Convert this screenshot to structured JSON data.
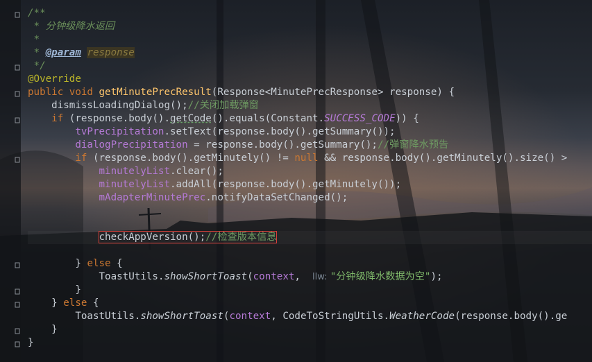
{
  "editor": {
    "lines": [
      {
        "indent": "",
        "tokens": [
          {
            "t": "/**",
            "c": "doc"
          }
        ]
      },
      {
        "indent": " ",
        "tokens": [
          {
            "t": "* 分钟级降水返回",
            "c": "doc"
          }
        ]
      },
      {
        "indent": " ",
        "tokens": [
          {
            "t": "*",
            "c": "doc"
          }
        ]
      },
      {
        "indent": " ",
        "tokens": [
          {
            "t": "* ",
            "c": "doc"
          },
          {
            "t": "@param",
            "c": "tag"
          },
          {
            "t": " ",
            "c": "doc"
          },
          {
            "t": "response",
            "c": "param"
          }
        ]
      },
      {
        "indent": " ",
        "tokens": [
          {
            "t": "*/",
            "c": "doc"
          }
        ]
      },
      {
        "indent": "",
        "tokens": [
          {
            "t": "@Override",
            "c": "ann"
          }
        ]
      },
      {
        "indent": "",
        "tokens": [
          {
            "t": "public void ",
            "c": "kw"
          },
          {
            "t": "getMinutePrecResult",
            "c": "meth"
          },
          {
            "t": "(Response<MinutePrecResponse> response) {",
            "c": "plain"
          }
        ]
      },
      {
        "indent": "    ",
        "tokens": [
          {
            "t": "dismissLoadingDialog();",
            "c": "plain"
          },
          {
            "t": "//关闭加载弹窗",
            "c": "com"
          }
        ]
      },
      {
        "indent": "    ",
        "tokens": [
          {
            "t": "if ",
            "c": "kw"
          },
          {
            "t": "(response.body().",
            "c": "plain"
          },
          {
            "t": "getCode",
            "c": "plain-dotted"
          },
          {
            "t": "().equals(Constant.",
            "c": "plain"
          },
          {
            "t": "SUCCESS_CODE",
            "c": "static"
          },
          {
            "t": ")) {",
            "c": "plain"
          }
        ]
      },
      {
        "indent": "        ",
        "tokens": [
          {
            "t": "tvPrecipitation",
            "c": "field"
          },
          {
            "t": ".setText(response.body().getSummary());",
            "c": "plain"
          }
        ]
      },
      {
        "indent": "        ",
        "tokens": [
          {
            "t": "dialogPrecipitation",
            "c": "field"
          },
          {
            "t": " = response.body().getSummary();",
            "c": "plain"
          },
          {
            "t": "//弹窗降水预告",
            "c": "com"
          }
        ]
      },
      {
        "indent": "        ",
        "tokens": [
          {
            "t": "if ",
            "c": "kw"
          },
          {
            "t": "(response.body().getMinutely() != ",
            "c": "plain"
          },
          {
            "t": "null ",
            "c": "kw"
          },
          {
            "t": "&& response.body().getMinutely().size() > ",
            "c": "plain"
          }
        ]
      },
      {
        "indent": "            ",
        "tokens": [
          {
            "t": "minutelyList",
            "c": "field"
          },
          {
            "t": ".clear();",
            "c": "plain"
          }
        ]
      },
      {
        "indent": "            ",
        "tokens": [
          {
            "t": "minutelyList",
            "c": "field"
          },
          {
            "t": ".addAll(response.body().getMinutely());",
            "c": "plain"
          }
        ]
      },
      {
        "indent": "            ",
        "tokens": [
          {
            "t": "mAdapterMinutePrec",
            "c": "field"
          },
          {
            "t": ".notifyDataSetChanged();",
            "c": "plain"
          }
        ]
      },
      {
        "indent": "",
        "tokens": []
      },
      {
        "indent": "",
        "tokens": []
      },
      {
        "indent": "            ",
        "highlight": true,
        "tokens": [
          {
            "t": "checkAppVersion();",
            "c": "plain"
          },
          {
            "t": "//检查版本信息",
            "c": "com"
          }
        ]
      },
      {
        "indent": "",
        "tokens": []
      },
      {
        "indent": "        ",
        "tokens": [
          {
            "t": "} ",
            "c": "plain"
          },
          {
            "t": "else ",
            "c": "kw"
          },
          {
            "t": "{",
            "c": "plain"
          }
        ]
      },
      {
        "indent": "            ",
        "tokens": [
          {
            "t": "ToastUtils.",
            "c": "plain"
          },
          {
            "t": "showShortToast",
            "c": "plain-italic"
          },
          {
            "t": "(",
            "c": "plain"
          },
          {
            "t": "context",
            "c": "field"
          },
          {
            "t": ",  ",
            "c": "plain"
          },
          {
            "t": "llw: ",
            "c": "hint"
          },
          {
            "t": "\"分钟级降水数据为空\"",
            "c": "str"
          },
          {
            "t": ");",
            "c": "plain"
          }
        ]
      },
      {
        "indent": "        ",
        "tokens": [
          {
            "t": "}",
            "c": "plain"
          }
        ]
      },
      {
        "indent": "    ",
        "tokens": [
          {
            "t": "} ",
            "c": "plain"
          },
          {
            "t": "else ",
            "c": "kw"
          },
          {
            "t": "{",
            "c": "plain"
          }
        ]
      },
      {
        "indent": "        ",
        "tokens": [
          {
            "t": "ToastUtils.",
            "c": "plain"
          },
          {
            "t": "showShortToast",
            "c": "plain-italic"
          },
          {
            "t": "(",
            "c": "plain"
          },
          {
            "t": "context",
            "c": "field"
          },
          {
            "t": ", CodeToStringUtils.",
            "c": "plain"
          },
          {
            "t": "WeatherCode",
            "c": "plain-italic"
          },
          {
            "t": "(response.body().ge",
            "c": "plain"
          }
        ]
      },
      {
        "indent": "    ",
        "tokens": [
          {
            "t": "}",
            "c": "plain"
          }
        ]
      },
      {
        "indent": "",
        "tokens": [
          {
            "t": "}",
            "c": "plain"
          }
        ]
      }
    ]
  },
  "colors": {
    "keyword": "#cc7832",
    "annotation": "#bbb529",
    "method": "#ffc66d",
    "field": "#b57ad6",
    "comment": "#6e9a62",
    "string": "#7fb96a",
    "highlight_border": "#d9403a"
  }
}
